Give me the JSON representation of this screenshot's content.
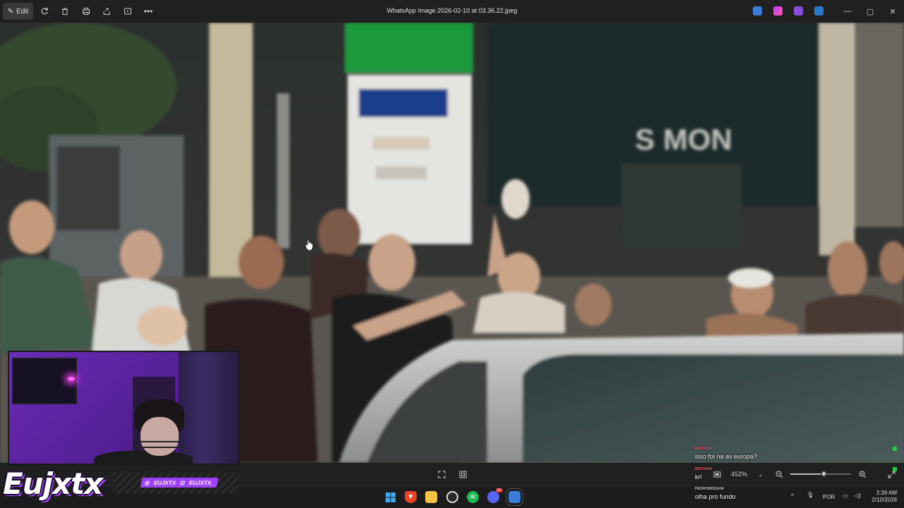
{
  "titlebar": {
    "edit_label": "Edit",
    "title": "WhatsApp Image 2026-02-10 at 03.36.22.jpeg"
  },
  "photo": {
    "signs": {
      "shop_sign": "S MON"
    }
  },
  "imgbar": {
    "zoom_value": "452%",
    "zoom_slider_fraction": 0.55
  },
  "taskbar": {
    "language": "POR",
    "time": "3:39 AM",
    "date": "2/10/2026",
    "discord_badge": "9+"
  },
  "overlay": {
    "brand_name": "Eujxtx",
    "social_1": "EUJXTX",
    "social_2": "EUJXTX_",
    "chat": [
      {
        "user": "MEIZADA",
        "message": "isso foi na av europa?",
        "user_color": "#ff5a7a"
      },
      {
        "user": "MEIZADA",
        "message": "krl",
        "user_color": "#ff5a7a"
      },
      {
        "user": "PEDROMISSANI",
        "message": "olha pro fundo",
        "user_color": "#cccccc"
      }
    ]
  },
  "colors": {
    "accent_purple": "#a040ff",
    "titlebar_bg": "#202020",
    "chat_green": "#22cc44"
  }
}
